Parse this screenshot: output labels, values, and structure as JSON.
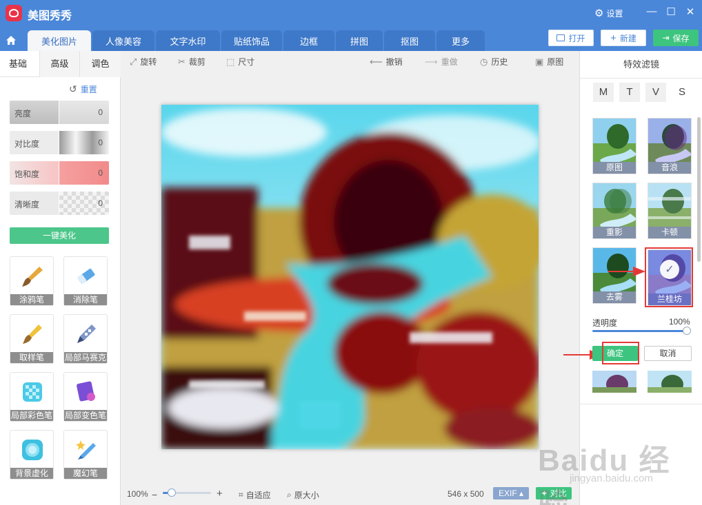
{
  "app": {
    "title": "美图秀秀",
    "settings_label": "设置"
  },
  "window_controls": {
    "minimize": "—",
    "maximize": "☐",
    "close": "✕"
  },
  "tabs": [
    {
      "label": "美化图片",
      "active": true
    },
    {
      "label": "人像美容"
    },
    {
      "label": "文字水印"
    },
    {
      "label": "贴纸饰品"
    },
    {
      "label": "边框"
    },
    {
      "label": "拼图"
    },
    {
      "label": "抠图"
    },
    {
      "label": "更多"
    }
  ],
  "file_buttons": {
    "open": "打开",
    "new": "新建",
    "save": "保存"
  },
  "left_panel": {
    "subtabs": [
      "基础",
      "高级",
      "调色"
    ],
    "reset_label": "重置",
    "sliders": [
      {
        "label": "亮度",
        "value": "0"
      },
      {
        "label": "对比度",
        "value": "0"
      },
      {
        "label": "饱和度",
        "value": "0"
      },
      {
        "label": "清晰度",
        "value": "0"
      }
    ],
    "one_key_label": "一键美化",
    "tools": [
      {
        "label": "涂鸦笔",
        "icon": "brush-icon"
      },
      {
        "label": "消除笔",
        "icon": "eraser-icon"
      },
      {
        "label": "取样笔",
        "icon": "sample-brush-icon"
      },
      {
        "label": "局部马赛克",
        "icon": "mosaic-pen-icon"
      },
      {
        "label": "局部彩色笔",
        "icon": "color-pen-icon"
      },
      {
        "label": "局部变色笔",
        "icon": "recolor-pen-icon"
      },
      {
        "label": "背景虚化",
        "icon": "blur-icon"
      },
      {
        "label": "魔幻笔",
        "icon": "magic-pen-icon"
      }
    ]
  },
  "toolbar": {
    "rotate": "旋转",
    "crop": "裁剪",
    "size": "尺寸",
    "undo": "撤销",
    "redo": "重做",
    "history": "历史",
    "original": "原图"
  },
  "status": {
    "zoom": "100%",
    "fit": "自适应",
    "actual_size": "原大小",
    "dimensions": "546 x 500",
    "exif": "EXIF ▴",
    "compare": "对比",
    "zoom_level": 0.18
  },
  "right_panel": {
    "title": "特效滤镜",
    "categories": [
      "M",
      "T",
      "V",
      "S"
    ],
    "selected_category": "S",
    "filters": [
      {
        "label": "原图"
      },
      {
        "label": "音浪"
      },
      {
        "label": "重影"
      },
      {
        "label": "卡顿"
      },
      {
        "label": "去雾"
      },
      {
        "label": "兰桂坊",
        "selected": true
      }
    ],
    "opacity_label": "透明度",
    "opacity_value": "100%",
    "ok_label": "确定",
    "cancel_label": "取消"
  },
  "watermark": {
    "brand": "Baidu 经验",
    "url": "jingyan.baidu.com"
  },
  "colors": {
    "accent": "#4a87d9",
    "green": "#3dc47e",
    "highlight": "#e53935"
  }
}
